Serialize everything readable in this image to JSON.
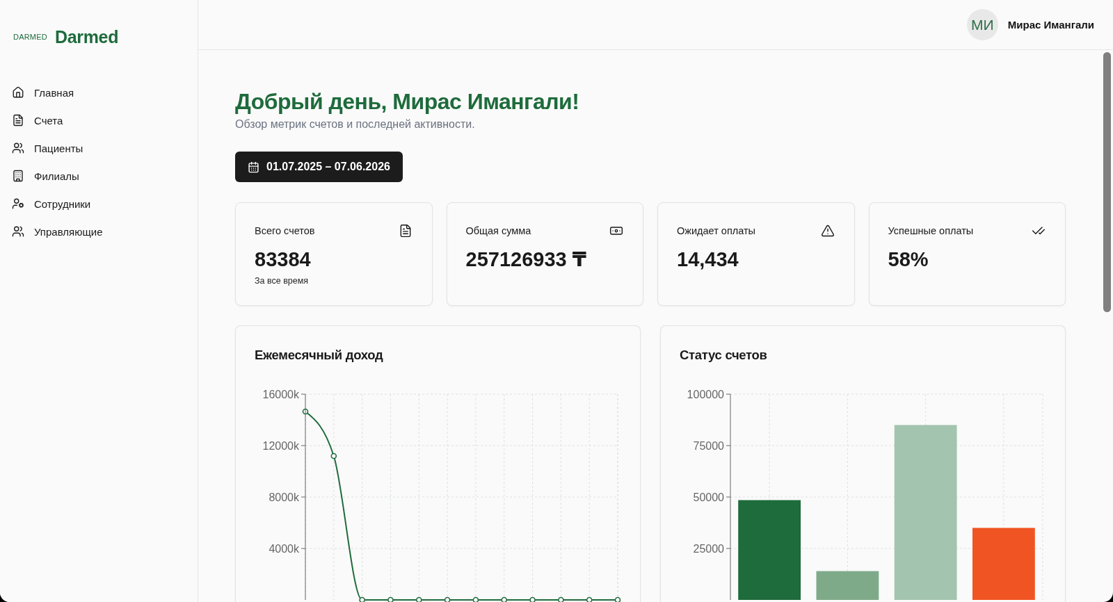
{
  "sidebar": {
    "logo_wordmark": "DARMED",
    "brand": "Darmed",
    "nav": [
      {
        "label": "Главная"
      },
      {
        "label": "Счета"
      },
      {
        "label": "Пациенты"
      },
      {
        "label": "Филиалы"
      },
      {
        "label": "Сотрудники"
      },
      {
        "label": "Управляющие"
      }
    ]
  },
  "header": {
    "user": {
      "initials": "МИ",
      "name": "Мирас Имангали"
    }
  },
  "greeting": {
    "title": "Добрый день, Мирас Имангали!",
    "subtitle": "Обзор метрик счетов и последней активности."
  },
  "date_range": {
    "label": "01.07.2025 – 07.06.2026"
  },
  "stats": [
    {
      "title": "Всего счетов",
      "value": "83384",
      "note": "За все время"
    },
    {
      "title": "Общая сумма",
      "value": "257126933 ₸"
    },
    {
      "title": "Ожидает оплаты",
      "value": "14,434"
    },
    {
      "title": "Успешные оплаты",
      "value": "58%"
    }
  ],
  "charts": [
    {
      "title": "Ежемесячный доход",
      "chart_data": {
        "type": "line",
        "grid": true,
        "series": [
          {
            "color": "#1e6b3c",
            "marker": true,
            "values": [
              14650,
              11190,
              0,
              0,
              0,
              0,
              0,
              0,
              0,
              0,
              0,
              0
            ]
          }
        ],
        "ylim": [
          0,
          16000
        ],
        "yticks": [
          {
            "value": 4000,
            "label": "4000k"
          },
          {
            "value": 8000,
            "label": "8000k"
          },
          {
            "value": 12000,
            "label": "12000k"
          },
          {
            "value": 16000,
            "label": "16000k"
          }
        ]
      }
    },
    {
      "title": "Статус счетов",
      "chart_data": {
        "type": "bar",
        "grid": true,
        "series": [
          {
            "color": "#1e6b3c",
            "values": [
              48500,
              null,
              null,
              null
            ]
          },
          {
            "color": "#7faa8a",
            "values": [
              null,
              14000,
              null,
              null
            ]
          },
          {
            "color": "#a3c4ae",
            "values": [
              null,
              null,
              85000,
              null
            ]
          },
          {
            "color": "#f05423",
            "values": [
              null,
              null,
              null,
              35000
            ]
          }
        ],
        "ylim": [
          0,
          100000
        ],
        "yticks": [
          25000,
          50000,
          75000,
          100000
        ]
      }
    }
  ]
}
